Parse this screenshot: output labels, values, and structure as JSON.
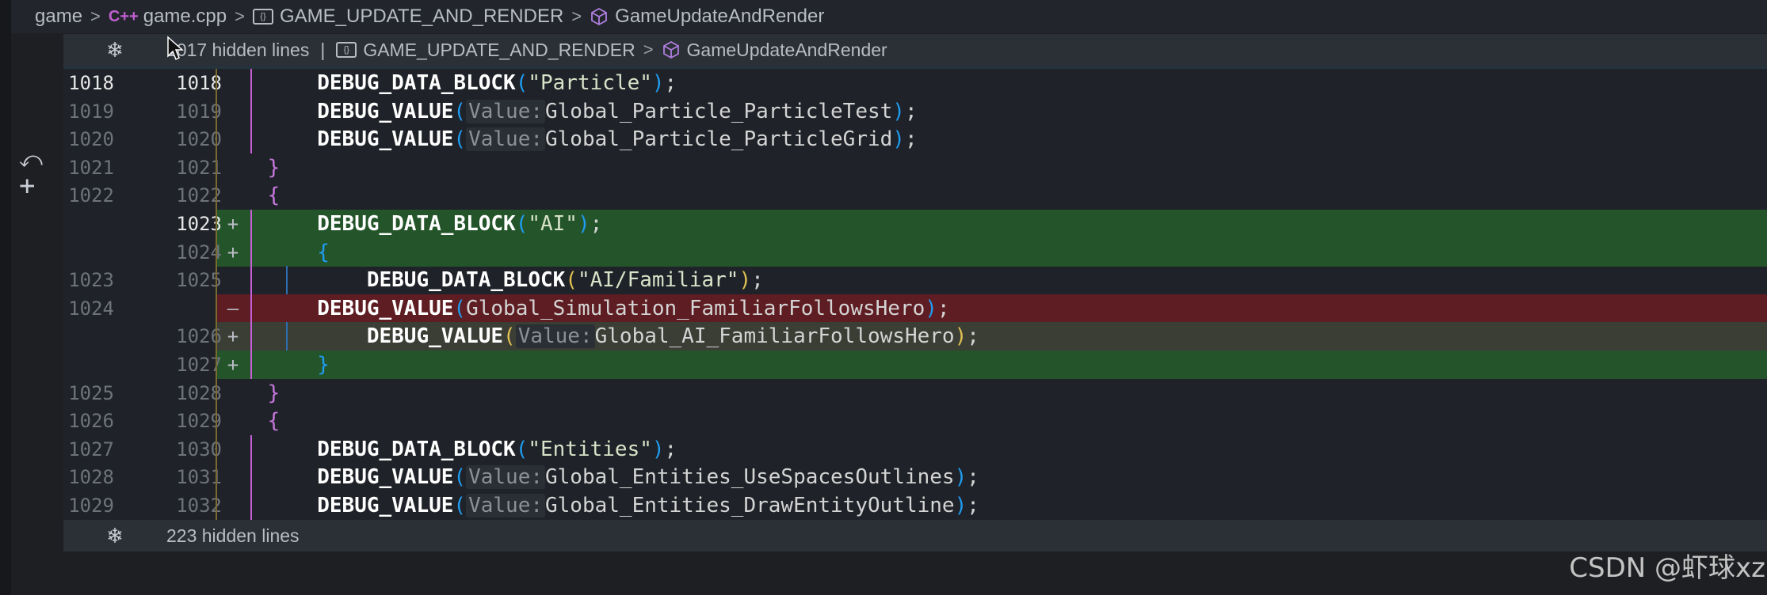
{
  "breadcrumb": {
    "items": [
      "game",
      "game.cpp",
      "GAME_UPDATE_AND_RENDER",
      "GameUpdateAndRender"
    ]
  },
  "top_fold": {
    "text": "1017 hidden lines",
    "separator": "|",
    "crumb1": "GAME_UPDATE_AND_RENDER",
    "crumb2": "GameUpdateAndRender"
  },
  "bottom_fold": {
    "text": "223 hidden lines"
  },
  "gutter_icons": [
    "revert-icon",
    "add-icon"
  ],
  "colors": {
    "added": "#2a5a2c",
    "removed": "#6a1e24",
    "modified": "#3a3d35"
  },
  "lines": [
    {
      "left": "1018",
      "right": "1018",
      "mark": "",
      "type": "normal",
      "current": true,
      "tokens": [
        {
          "t": "        "
        },
        {
          "t": "DEBUG_DATA_BLOCK",
          "c": "fn"
        },
        {
          "t": "(",
          "c": "p1"
        },
        {
          "t": "\"Particle\"",
          "c": "str"
        },
        {
          "t": ")",
          "c": "p1"
        },
        {
          "t": ";"
        }
      ]
    },
    {
      "left": "1019",
      "right": "1019",
      "mark": "",
      "type": "normal",
      "tokens": [
        {
          "t": "        "
        },
        {
          "t": "DEBUG_VALUE",
          "c": "fn"
        },
        {
          "t": "(",
          "c": "p1"
        },
        {
          "t": "Value:",
          "c": "hint"
        },
        {
          "t": "Global_Particle_ParticleTest"
        },
        {
          "t": ")",
          "c": "p1"
        },
        {
          "t": ";"
        }
      ]
    },
    {
      "left": "1020",
      "right": "1020",
      "mark": "",
      "type": "normal",
      "tokens": [
        {
          "t": "        "
        },
        {
          "t": "DEBUG_VALUE",
          "c": "fn"
        },
        {
          "t": "(",
          "c": "p1"
        },
        {
          "t": "Value:",
          "c": "hint"
        },
        {
          "t": "Global_Particle_ParticleGrid"
        },
        {
          "t": ")",
          "c": "p1"
        },
        {
          "t": ";"
        }
      ]
    },
    {
      "left": "1021",
      "right": "1021",
      "mark": "",
      "type": "normal",
      "tokens": [
        {
          "t": "    "
        },
        {
          "t": "}",
          "c": "brace"
        }
      ]
    },
    {
      "left": "1022",
      "right": "1022",
      "mark": "",
      "type": "normal",
      "tokens": [
        {
          "t": "    "
        },
        {
          "t": "{",
          "c": "brace"
        }
      ]
    },
    {
      "left": "",
      "right": "1023",
      "mark": "+",
      "type": "added",
      "current": true,
      "tokens": [
        {
          "t": "        "
        },
        {
          "t": "DEBUG_DATA_BLOCK",
          "c": "fn"
        },
        {
          "t": "(",
          "c": "p1"
        },
        {
          "t": "\"AI\"",
          "c": "str"
        },
        {
          "t": ")",
          "c": "p1"
        },
        {
          "t": ";"
        }
      ]
    },
    {
      "left": "",
      "right": "1024",
      "mark": "+",
      "type": "added",
      "tokens": [
        {
          "t": "        "
        },
        {
          "t": "{",
          "c": "brace2"
        }
      ]
    },
    {
      "left": "1023",
      "right": "1025",
      "mark": "",
      "type": "normal",
      "tokens": [
        {
          "t": "            "
        },
        {
          "t": "DEBUG_DATA_BLOCK",
          "c": "fn"
        },
        {
          "t": "(",
          "c": "p2"
        },
        {
          "t": "\"AI/Familiar\"",
          "c": "str"
        },
        {
          "t": ")",
          "c": "p2"
        },
        {
          "t": ";"
        }
      ]
    },
    {
      "left": "1024",
      "right": "",
      "mark": "—",
      "type": "removed",
      "tokens": [
        {
          "t": "        "
        },
        {
          "t": "DEBUG_VALUE",
          "c": "fn"
        },
        {
          "t": "(",
          "c": "p1"
        },
        {
          "t": "Global_Simulation_FamiliarFollowsHero"
        },
        {
          "t": ")",
          "c": "p1"
        },
        {
          "t": ";"
        }
      ]
    },
    {
      "left": "",
      "right": "1026",
      "mark": "+",
      "type": "modified",
      "tokens": [
        {
          "t": "            "
        },
        {
          "t": "DEBUG_VALUE",
          "c": "fn"
        },
        {
          "t": "(",
          "c": "p2"
        },
        {
          "t": "Value:",
          "c": "hint"
        },
        {
          "t": "Global_AI_FamiliarFollowsHero"
        },
        {
          "t": ")",
          "c": "p2"
        },
        {
          "t": ";"
        }
      ]
    },
    {
      "left": "",
      "right": "1027",
      "mark": "+",
      "type": "added",
      "tokens": [
        {
          "t": "        "
        },
        {
          "t": "}",
          "c": "brace2"
        }
      ]
    },
    {
      "left": "1025",
      "right": "1028",
      "mark": "",
      "type": "normal",
      "tokens": [
        {
          "t": "    "
        },
        {
          "t": "}",
          "c": "brace"
        }
      ]
    },
    {
      "left": "1026",
      "right": "1029",
      "mark": "",
      "type": "normal",
      "tokens": [
        {
          "t": "    "
        },
        {
          "t": "{",
          "c": "brace"
        }
      ]
    },
    {
      "left": "1027",
      "right": "1030",
      "mark": "",
      "type": "normal",
      "tokens": [
        {
          "t": "        "
        },
        {
          "t": "DEBUG_DATA_BLOCK",
          "c": "fn"
        },
        {
          "t": "(",
          "c": "p1"
        },
        {
          "t": "\"Entities\"",
          "c": "str"
        },
        {
          "t": ")",
          "c": "p1"
        },
        {
          "t": ";"
        }
      ]
    },
    {
      "left": "1028",
      "right": "1031",
      "mark": "",
      "type": "normal",
      "tokens": [
        {
          "t": "        "
        },
        {
          "t": "DEBUG_VALUE",
          "c": "fn"
        },
        {
          "t": "(",
          "c": "p1"
        },
        {
          "t": "Value:",
          "c": "hint"
        },
        {
          "t": "Global_Entities_UseSpacesOutlines"
        },
        {
          "t": ")",
          "c": "p1"
        },
        {
          "t": ";"
        }
      ]
    },
    {
      "left": "1029",
      "right": "1032",
      "mark": "",
      "type": "normal",
      "tokens": [
        {
          "t": "        "
        },
        {
          "t": "DEBUG_VALUE",
          "c": "fn"
        },
        {
          "t": "(",
          "c": "p1"
        },
        {
          "t": "Value:",
          "c": "hint"
        },
        {
          "t": "Global_Entities_DrawEntityOutline"
        },
        {
          "t": ")",
          "c": "p1"
        },
        {
          "t": ";"
        }
      ]
    }
  ],
  "watermark": "CSDN @虾球xz"
}
